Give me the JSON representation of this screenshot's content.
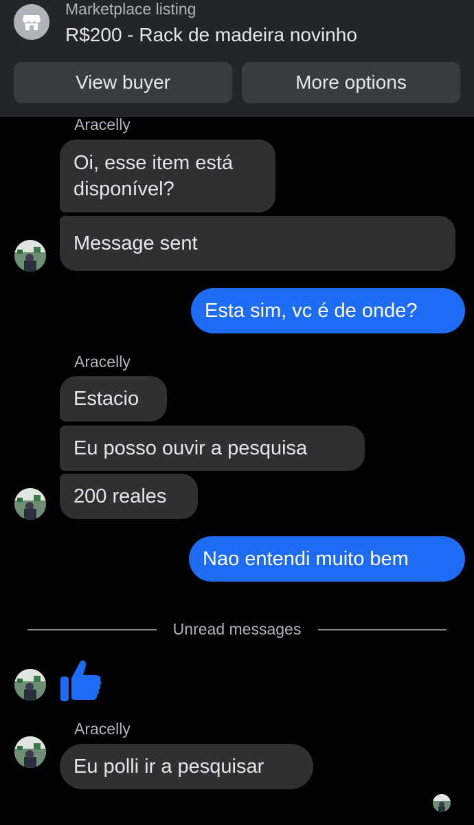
{
  "header": {
    "kicker": "Marketplace listing",
    "title": "R$200 - Rack de madeira novinho",
    "buttons": {
      "view_buyer": "View buyer",
      "more_options": "More options"
    },
    "icon": "marketplace-store-icon"
  },
  "messages": [
    {
      "id": "m1",
      "from": "Aracelly",
      "sender_label": "Aracelly",
      "text_lines": [
        "Oi, esse item está",
        "disponível?"
      ]
    },
    {
      "id": "m2",
      "from": "Aracelly",
      "text": "Message sent"
    },
    {
      "id": "m3",
      "from": "me",
      "text": "Esta sim, vc é de onde?"
    },
    {
      "id": "m4",
      "from": "Aracelly",
      "sender_label": "Aracelly",
      "text": "Estacio"
    },
    {
      "id": "m5",
      "from": "Aracelly",
      "text": "Eu posso ouvir a pesquisa"
    },
    {
      "id": "m6",
      "from": "Aracelly",
      "text": "200 reales"
    },
    {
      "id": "m7",
      "from": "me",
      "text": "Nao entendi muito bem"
    },
    {
      "id": "m8",
      "from": "Aracelly",
      "type": "like",
      "icon": "thumbs-up-icon"
    },
    {
      "id": "m9",
      "from": "Aracelly",
      "sender_label": "Aracelly",
      "text": "Eu polli ir a pesquisar"
    }
  ],
  "unread_divider": "Unread messages",
  "colors": {
    "background": "#000000",
    "header_bg": "#242526",
    "incoming_bubble": "#303030",
    "outgoing_bubble": "#1e6cf4",
    "like_icon": "#1e6cf4"
  }
}
